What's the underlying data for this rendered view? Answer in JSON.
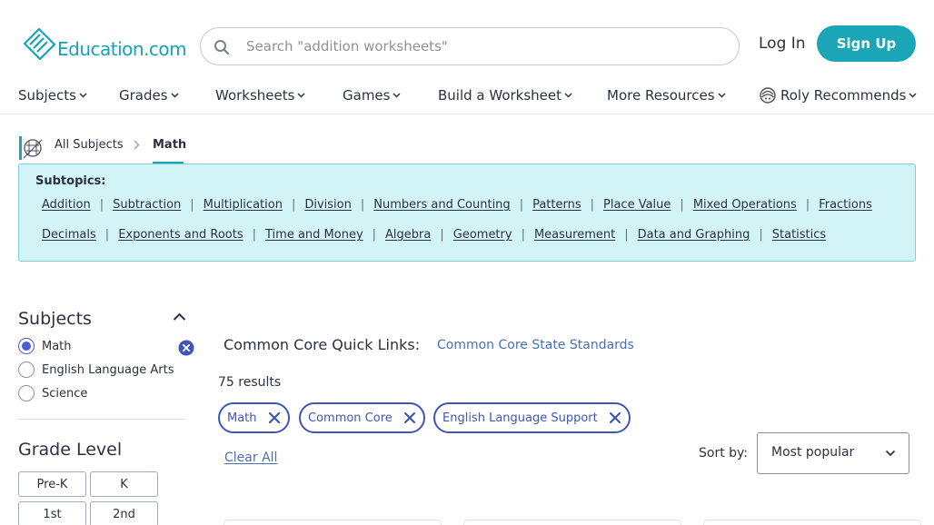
{
  "header": {
    "logo_text": "Education.com",
    "search_placeholder": "Search \"addition worksheets\"",
    "login_label": "Log In",
    "signup_label": "Sign Up"
  },
  "nav": {
    "items": [
      {
        "label": "Subjects"
      },
      {
        "label": "Grades"
      },
      {
        "label": "Worksheets"
      },
      {
        "label": "Games"
      },
      {
        "label": "Build a Worksheet"
      },
      {
        "label": "More Resources"
      },
      {
        "label": "Roly Recommends"
      }
    ]
  },
  "breadcrumb": {
    "all_subjects": "All Subjects",
    "current": "Math"
  },
  "subtopics": {
    "title": "Subtopics:",
    "row1": [
      "Addition",
      "Subtraction",
      "Multiplication",
      "Division",
      "Numbers and Counting",
      "Patterns",
      "Place Value",
      "Mixed Operations",
      "Fractions"
    ],
    "row2": [
      "Decimals",
      "Exponents and Roots",
      "Time and Money",
      "Algebra",
      "Geometry",
      "Measurement",
      "Data and Graphing",
      "Statistics"
    ],
    "separator": "|"
  },
  "sidebar": {
    "subjects_heading": "Subjects",
    "subjects": [
      {
        "label": "Math",
        "checked": true
      },
      {
        "label": "English Language Arts",
        "checked": false
      },
      {
        "label": "Science",
        "checked": false
      }
    ],
    "grade_heading": "Grade Level",
    "grades": [
      "Pre-K",
      "K",
      "1st",
      "2nd"
    ]
  },
  "main": {
    "common_core_label": "Common Core Quick Links:",
    "common_core_link": "Common Core State Standards",
    "results_count": "75 results",
    "filters": [
      "Math",
      "Common Core",
      "English Language Support"
    ],
    "clear_all": "Clear All",
    "sort_label": "Sort by:",
    "sort_value": "Most popular"
  },
  "colors": {
    "brand_teal": "#1aa6b7",
    "chip_blue": "#3e56b8",
    "link_blue": "#4a6fb5",
    "subtopics_bg": "#d3f4f6"
  }
}
